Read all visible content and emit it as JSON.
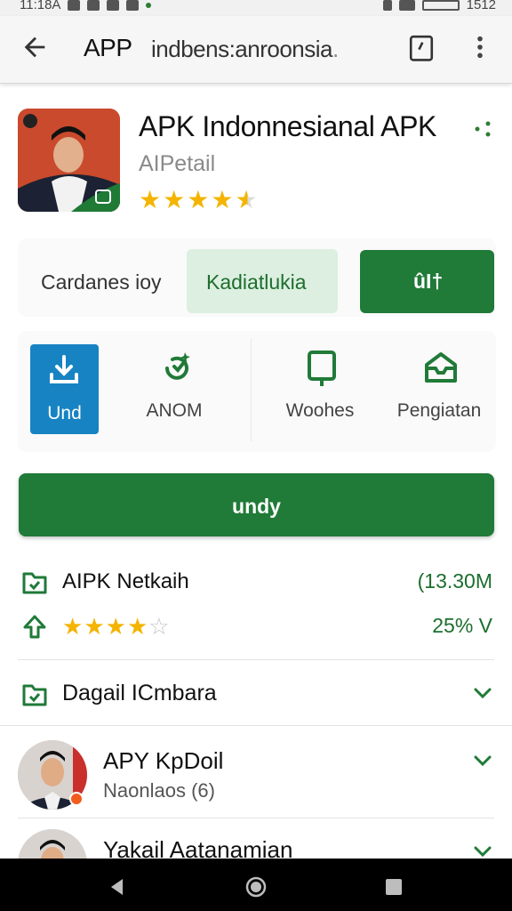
{
  "status_bar": {
    "time": "11:18A",
    "right_text": "1512",
    "accent": "#2e7d32"
  },
  "appbar": {
    "title": "APP",
    "subtitle": "indbens:anroonsia",
    "subtitle_tail": ".",
    "icons": [
      "back-arrow-icon",
      "tabs-icon",
      "more-vert-icon"
    ]
  },
  "app": {
    "name": "APK Indonnesianal APK",
    "developer": "AIPetail",
    "rating_stars": 4.5
  },
  "tabs": {
    "plain_label": "Cardanes ioy",
    "selected_label": "Kadiatlukia",
    "button_label": "ûI†"
  },
  "actions": [
    {
      "label": "Und",
      "icon": "download-icon",
      "primary": true
    },
    {
      "label": "ANOM",
      "icon": "refresh-sparkle-icon"
    },
    {
      "label": "Woohes",
      "icon": "device-icon"
    },
    {
      "label": "Pengiatan",
      "icon": "inbox-icon"
    }
  ],
  "main_button": {
    "label": "undy"
  },
  "info": {
    "row1": {
      "label": "AIPK Netkaih",
      "value": "(13.30M"
    },
    "row2": {
      "stars": 4,
      "value": "25% V"
    }
  },
  "section": {
    "label": "Dagail ICmbara"
  },
  "people": [
    {
      "name": "APY KpDoil",
      "meta": "Naonlaos (6)"
    },
    {
      "name": "Yakail Aatanamian",
      "meta": ""
    }
  ],
  "colors": {
    "brand_green": "#207a38",
    "light_green": "#dcefe0",
    "primary_blue": "#1783c2",
    "star": "#f4b400"
  }
}
